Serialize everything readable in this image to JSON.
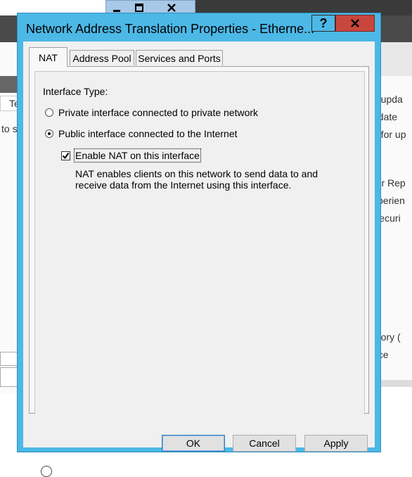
{
  "background": {
    "right_texts": [
      "d upda",
      "odate",
      "d for up",
      "ror Rep",
      "xperien",
      " Securi",
      "mory (",
      "ace"
    ],
    "left_column_header": "Te",
    "left_text": "to s",
    "top_window_controls": [
      "minimize-icon",
      "maximize-icon",
      "close-icon"
    ]
  },
  "dialog": {
    "title": "Network Address Translation Properties - Etherne...",
    "help_label": "?",
    "close_label": "X",
    "tabs": [
      {
        "label": "NAT",
        "active": true
      },
      {
        "label": "Address Pool",
        "active": false
      },
      {
        "label": "Services and Ports",
        "active": false
      }
    ],
    "interface_type_label": "Interface Type:",
    "radio_private": "Private interface connected to private network",
    "radio_public": "Public interface connected to the Internet",
    "selected_interface": "public",
    "enable_nat_label": "Enable NAT on this interface",
    "enable_nat_checked": true,
    "description": "NAT enables clients on this network to send data to and receive data from the Internet using this interface.",
    "buttons": {
      "ok": "OK",
      "cancel": "Cancel",
      "apply": "Apply"
    }
  },
  "colors": {
    "title_bar": "#4cb8e6",
    "close_button": "#c9463c",
    "dialog_bg": "#f0f0f0"
  }
}
